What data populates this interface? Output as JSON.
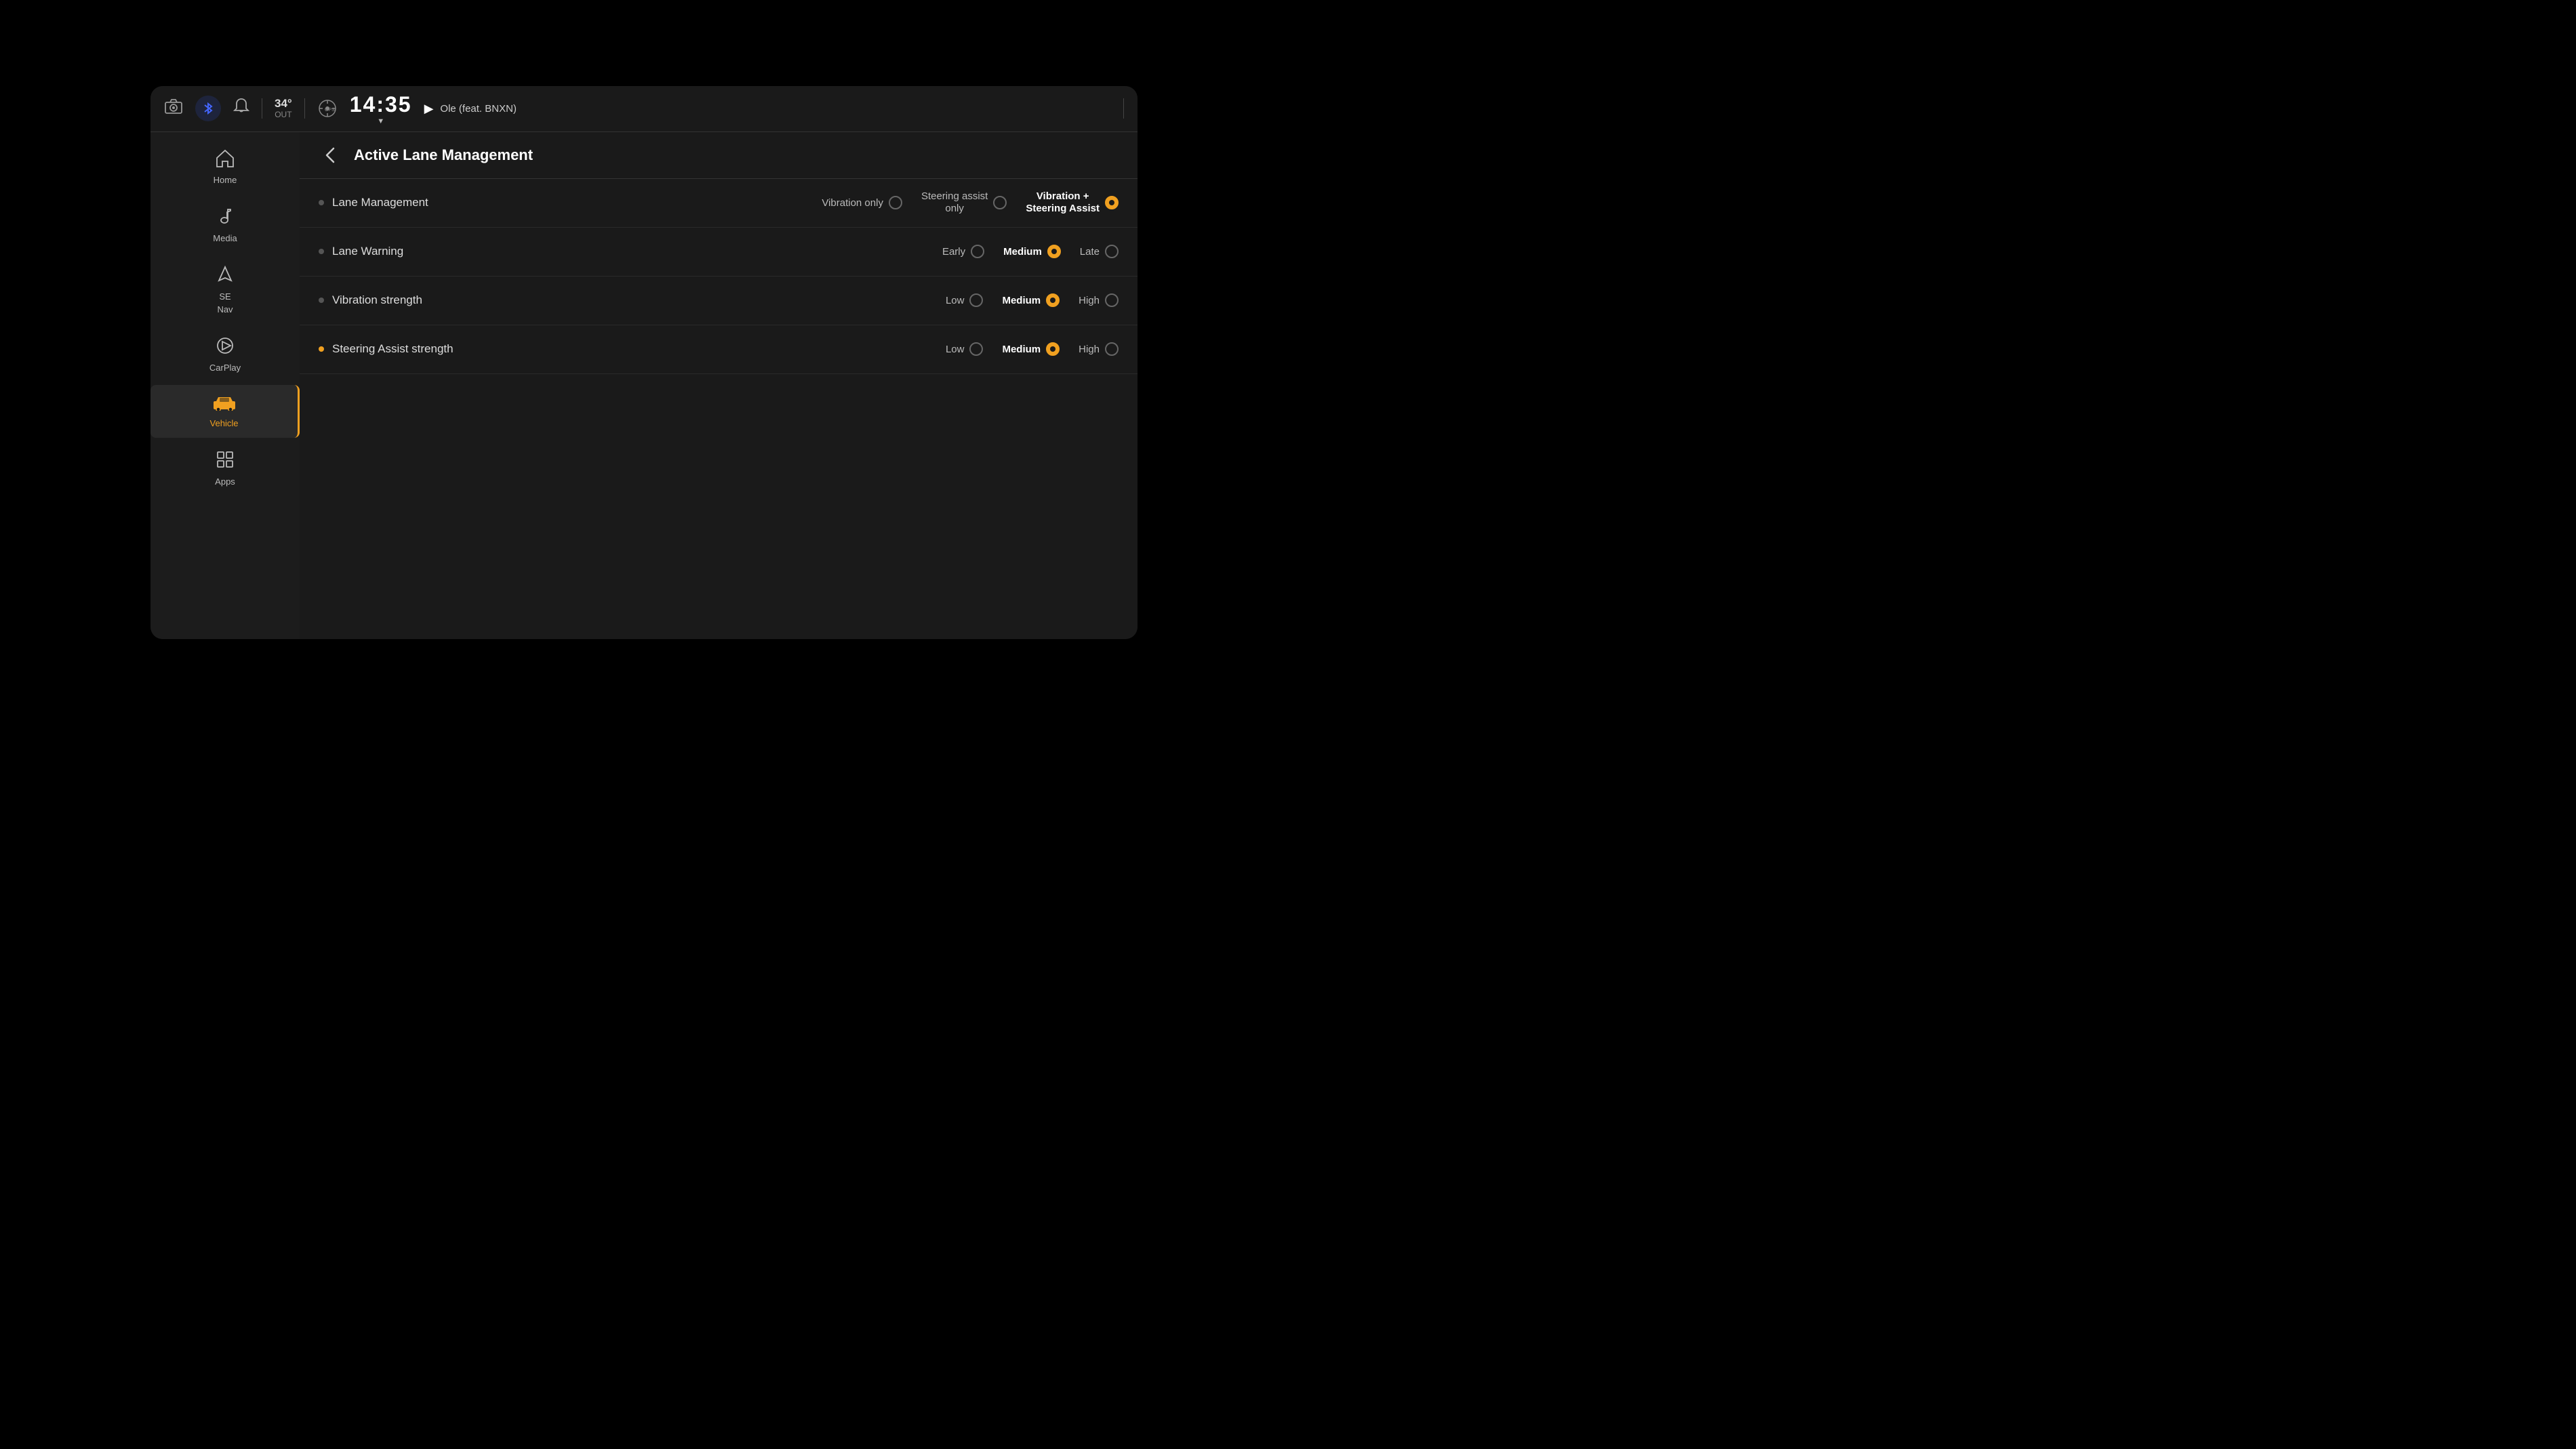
{
  "header": {
    "temperature": {
      "value": "34°",
      "label": "OUT"
    },
    "time": "14:35",
    "music": {
      "title": "Ole (feat. BNXN)"
    }
  },
  "sidebar": {
    "items": [
      {
        "id": "home",
        "label": "Home",
        "icon": "🏠",
        "active": false
      },
      {
        "id": "media",
        "label": "Media",
        "icon": "♪",
        "active": false
      },
      {
        "id": "nav",
        "label": "Nav",
        "icon": "◭",
        "active": false
      },
      {
        "id": "carplay",
        "label": "CarPlay",
        "icon": "▶",
        "active": false
      },
      {
        "id": "vehicle",
        "label": "Vehicle",
        "icon": "🚗",
        "active": true
      },
      {
        "id": "apps",
        "label": "Apps",
        "icon": "⊞",
        "active": false
      }
    ]
  },
  "page": {
    "back_label": "‹",
    "title": "Active Lane Management",
    "settings": [
      {
        "id": "lane-management",
        "name": "Lane Management",
        "options": [
          {
            "id": "vibration-only",
            "label": "Vibration only",
            "selected": false
          },
          {
            "id": "steering-assist-only",
            "label": "Steering assist only",
            "selected": false
          },
          {
            "id": "vibration-steering",
            "label": "Vibration + Steering Assist",
            "selected": true
          }
        ]
      },
      {
        "id": "lane-warning",
        "name": "Lane Warning",
        "options": [
          {
            "id": "early",
            "label": "Early",
            "selected": false
          },
          {
            "id": "medium",
            "label": "Medium",
            "selected": true
          },
          {
            "id": "late",
            "label": "Late",
            "selected": false
          }
        ]
      },
      {
        "id": "vibration-strength",
        "name": "Vibration strength",
        "options": [
          {
            "id": "low",
            "label": "Low",
            "selected": false
          },
          {
            "id": "medium",
            "label": "Medium",
            "selected": true
          },
          {
            "id": "high",
            "label": "High",
            "selected": false
          }
        ]
      },
      {
        "id": "steering-assist-strength",
        "name": "Steering Assist strength",
        "options": [
          {
            "id": "low",
            "label": "Low",
            "selected": false
          },
          {
            "id": "medium",
            "label": "Medium",
            "selected": true
          },
          {
            "id": "high",
            "label": "High",
            "selected": false
          }
        ]
      }
    ]
  },
  "icons": {
    "camera": "📷",
    "bell": "🔔",
    "gps": "⊙",
    "bluetooth": "⚡",
    "back": "‹",
    "play": "▶"
  }
}
